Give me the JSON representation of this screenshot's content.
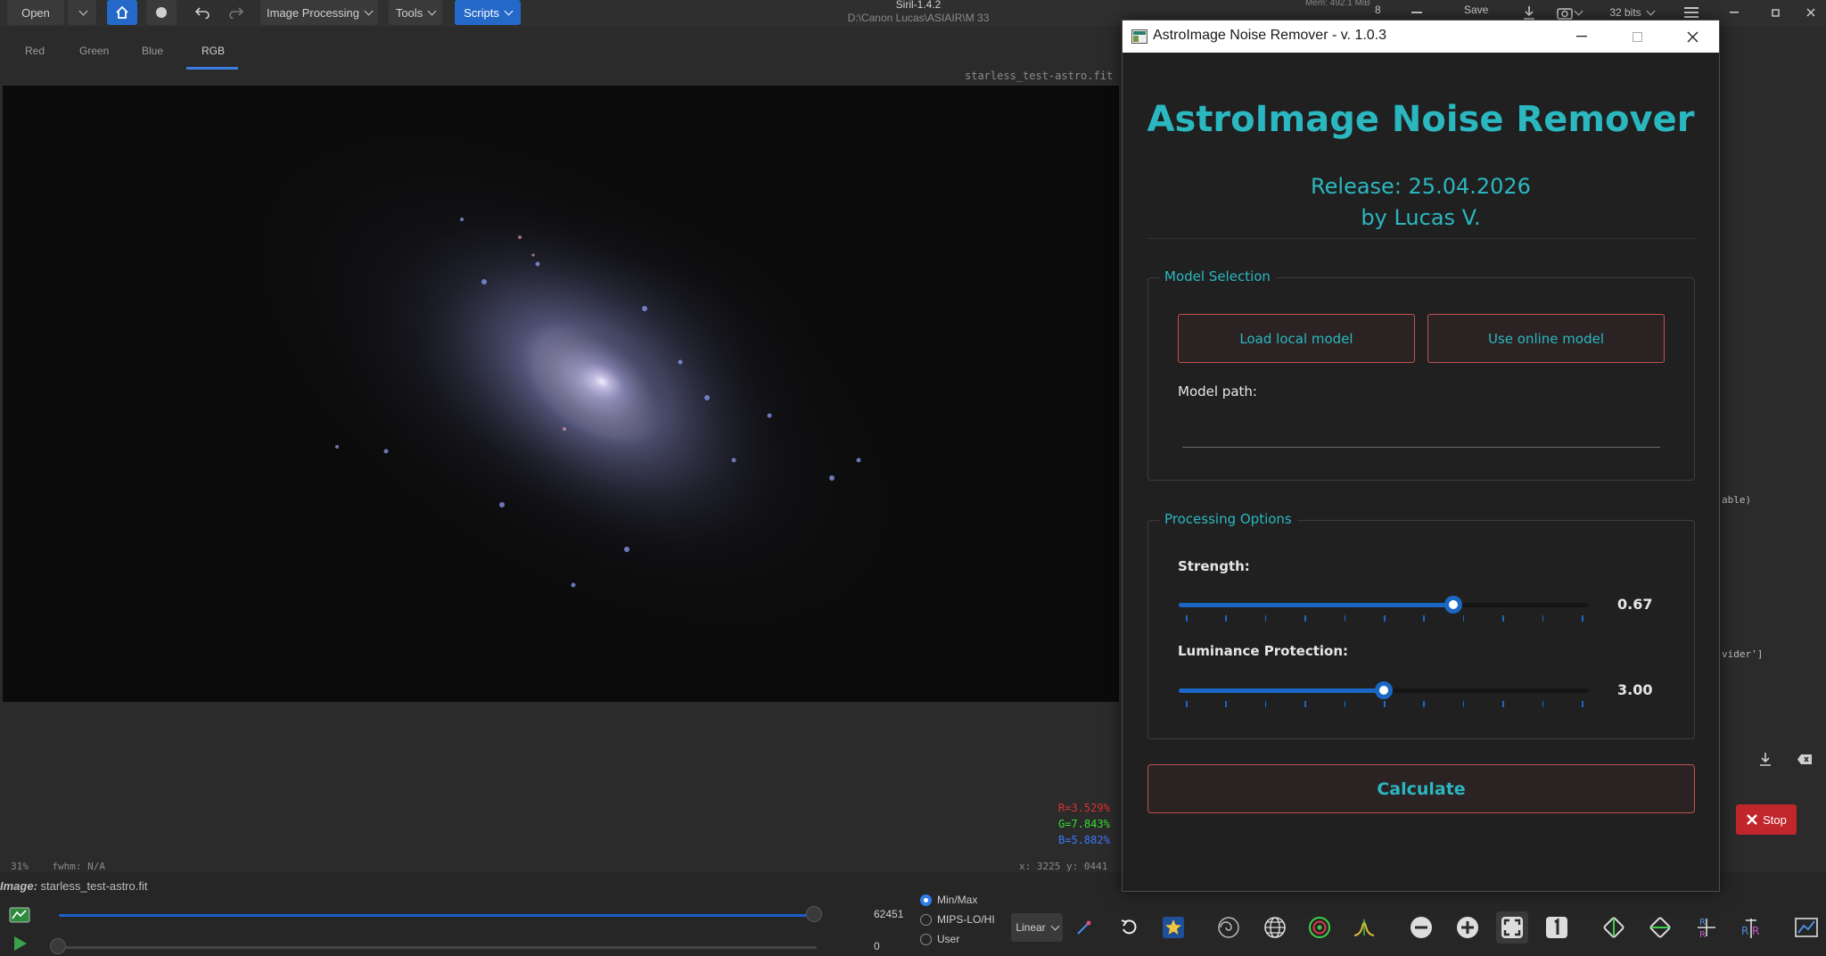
{
  "toolbar": {
    "open_label": "Open",
    "image_processing_label": "Image Processing",
    "tools_label": "Tools",
    "scripts_label": "Scripts",
    "app_title": "Siril-1.4.2",
    "path": "D:\\Canon Lucas\\ASIAIR\\M 33",
    "memory": "Mem: 492.1 MiB",
    "threads": "8",
    "save_label": "Save",
    "bit_depth_label": "32 bits"
  },
  "tabs": [
    {
      "label": "Red"
    },
    {
      "label": "Green"
    },
    {
      "label": "Blue"
    },
    {
      "label": "RGB"
    }
  ],
  "canvas": {
    "filename": "starless_test-astro.fit",
    "r_value": "R=3.529%",
    "g_value": "G=7.843%",
    "b_value": "B=5.882%",
    "zoom": "31%",
    "fwhm": "fwhm: N/A",
    "coords": "x: 3225  y: 0441"
  },
  "bottom": {
    "image_label_prefix": "Image:",
    "image_label_file": "starless_test-astro.fit",
    "max_value": "62451",
    "min_value": "0",
    "radio_minmax": "Min/Max",
    "radio_mipsl": "MIPS-LO/HI",
    "radio_user": "User",
    "stretch_label": "Linear"
  },
  "right": {
    "text_1": "able)",
    "text_2": "vider']",
    "stop_label": "Stop"
  },
  "dialog": {
    "window_title": "AstroImage Noise Remover - v. 1.0.3",
    "heading": "AstroImage Noise Remover",
    "release": "Release: 25.04.2026",
    "author": "by Lucas V.",
    "model_group_title": "Model Selection",
    "load_local_label": "Load local model",
    "use_online_label": "Use online model",
    "model_path_label": "Model path:",
    "model_path_value": "",
    "processing_group_title": "Processing Options",
    "strength_label": "Strength:",
    "strength_value": "0.67",
    "strength_fraction": 0.67,
    "luminance_label": "Luminance Protection:",
    "luminance_value": "3.00",
    "luminance_fraction": 0.5,
    "calculate_label": "Calculate",
    "accent_color": "#2bb7c0",
    "border_color": "#c05050"
  }
}
